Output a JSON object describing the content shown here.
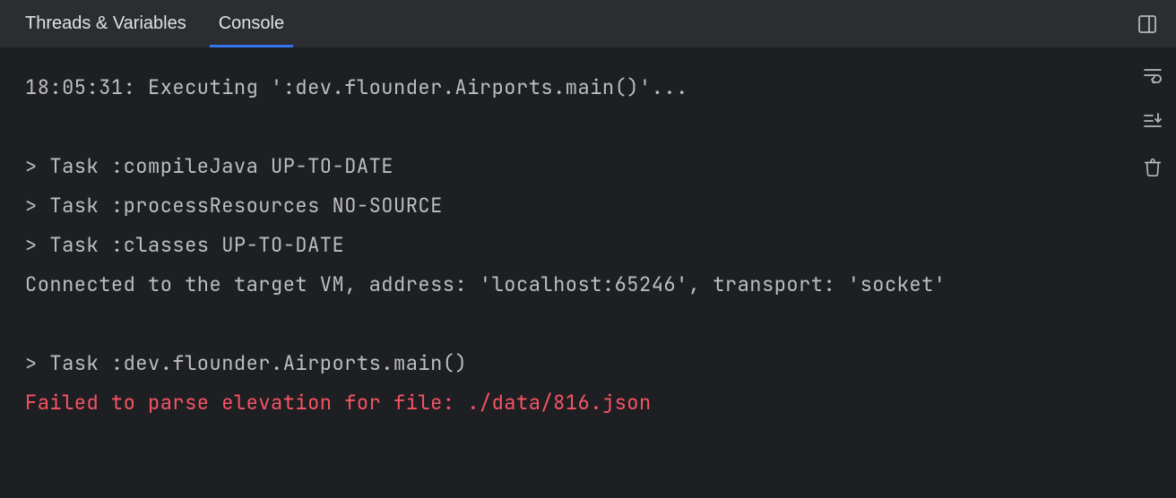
{
  "tabs": {
    "threads_variables": "Threads & Variables",
    "console": "Console"
  },
  "console": {
    "lines": [
      {
        "text": "18:05:31: Executing ':dev.flounder.Airports.main()'...",
        "kind": "plain"
      },
      {
        "text": "",
        "kind": "blank"
      },
      {
        "text": "> Task :compileJava UP-TO-DATE",
        "kind": "plain"
      },
      {
        "text": "> Task :processResources NO-SOURCE",
        "kind": "plain"
      },
      {
        "text": "> Task :classes UP-TO-DATE",
        "kind": "plain"
      },
      {
        "text": "Connected to the target VM, address: 'localhost:65246', transport: 'socket'",
        "kind": "plain"
      },
      {
        "text": "",
        "kind": "blank"
      },
      {
        "text": "> Task :dev.flounder.Airports.main()",
        "kind": "plain"
      },
      {
        "text": "Failed to parse elevation for file: ./data/816.json",
        "kind": "error"
      }
    ]
  }
}
